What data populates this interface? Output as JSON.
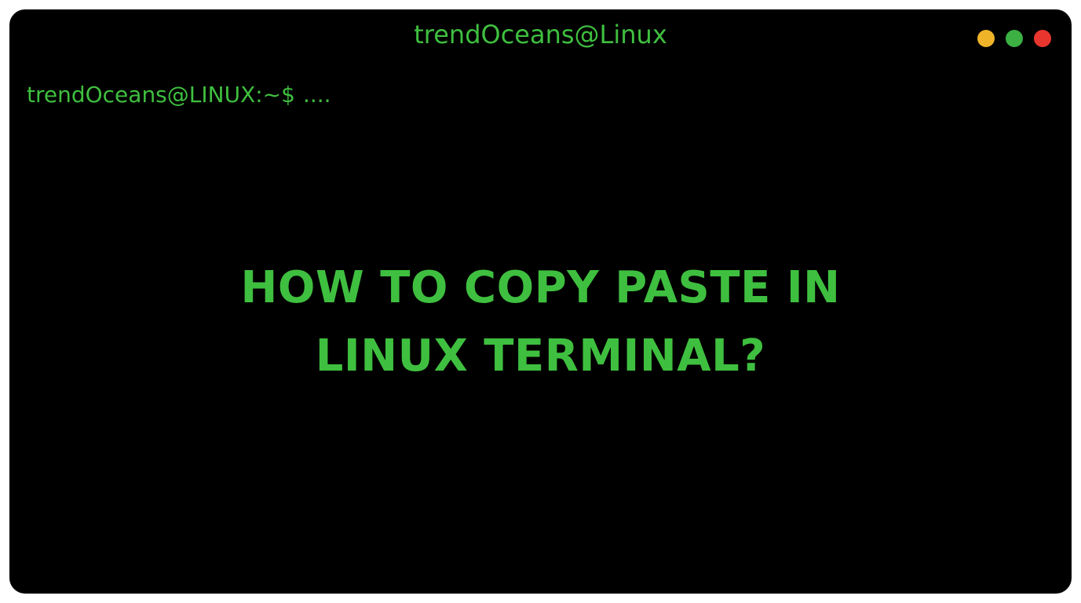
{
  "window": {
    "title": "trendOceans@Linux",
    "trafficLights": {
      "minimize": "yellow",
      "maximize": "green",
      "close": "red"
    }
  },
  "terminal": {
    "prompt": "trendOceans@LINUX:~$",
    "command": "...."
  },
  "headline": {
    "line1": "HOW TO COPY PASTE IN",
    "line2": "LINUX TERMINAL?"
  },
  "colors": {
    "background": "#000000",
    "foreground": "#3fbf3f",
    "yellow": "#f0b429",
    "green": "#3cb043",
    "red": "#e8362f"
  }
}
